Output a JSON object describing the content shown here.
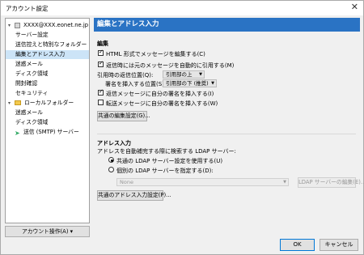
{
  "window": {
    "title": "アカウント設定",
    "close_glyph": "✕"
  },
  "tree": {
    "account": "XXXX@XXX.eonet.ne.jp",
    "account_children": [
      "サーバー設定",
      "送信控えと特別なフォルダー",
      "編集とアドレス入力",
      "迷惑メール",
      "ディスク領域",
      "開封確認",
      "セキュリティ"
    ],
    "local": "ローカルフォルダー",
    "local_children": [
      "迷惑メール",
      "ディスク領域"
    ],
    "smtp": "送信 (SMTP) サーバー",
    "expanded_glyph": "▾",
    "selected_index": 2
  },
  "account_ops": "アカウント操作(A) ▾",
  "header": "編集とアドレス入力",
  "compose": {
    "title": "編集",
    "html_label": "HTML 形式でメッセージを編集する(C)",
    "html_checked": true,
    "quote_label": "返信時には元のメッセージを自動的に引用する(M)",
    "quote_checked": true,
    "reply_pos_label": "引用時の返信位置(Q):",
    "reply_pos_value": "引用部の上",
    "sig_pos_label": "署名を挿入する位置(S):",
    "sig_pos_value": "引用部の下 (推奨)",
    "sig_reply_label": "返信メッセージに自分の署名を挿入する(I)",
    "sig_reply_checked": true,
    "sig_forward_label": "転送メッセージに自分の署名を挿入する(W)",
    "sig_forward_checked": false,
    "global_button": "共通の編集設定(G)..."
  },
  "addressing": {
    "title": "アドレス入力",
    "desc": "アドレスを自動補完する際に検索する LDAP サーバー:",
    "use_global_label": "共通の LDAP サーバー設定を使用する(U)",
    "use_global_checked": true,
    "use_different_label": "個別の LDAP サーバーを指定する(D):",
    "use_different_checked": false,
    "directory_value": "None",
    "edit_dirs_button": "LDAP サーバーの編集(E)...",
    "global_button": "共通のアドレス入力設定(P)..."
  },
  "footer": {
    "ok": "OK",
    "cancel": "キャンセル"
  }
}
